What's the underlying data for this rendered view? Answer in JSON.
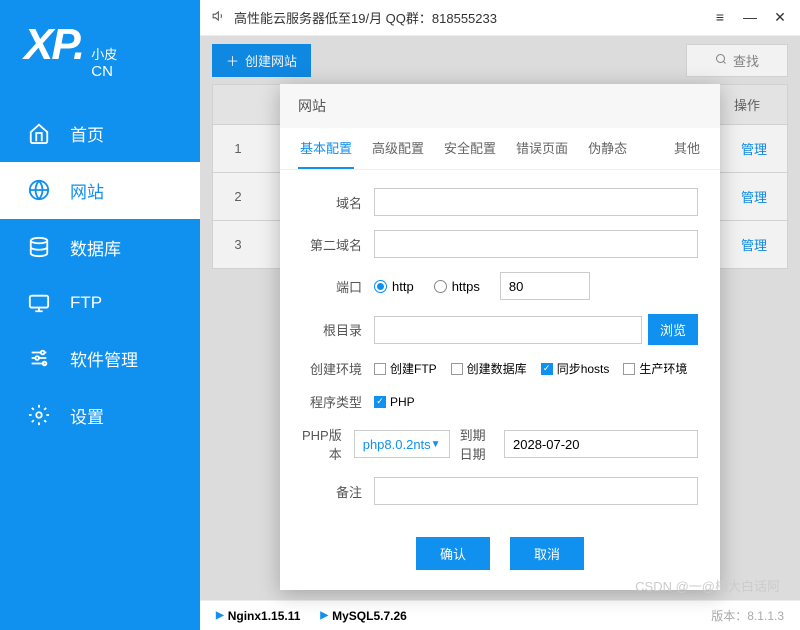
{
  "logo": {
    "main": "XP.",
    "sub1": "小皮",
    "sub2": "CN"
  },
  "titlebar": {
    "text": "高性能云服务器低至19/月  QQ群：818555233"
  },
  "nav": [
    {
      "label": "首页"
    },
    {
      "label": "网站"
    },
    {
      "label": "数据库"
    },
    {
      "label": "FTP"
    },
    {
      "label": "软件管理"
    },
    {
      "label": "设置"
    }
  ],
  "toolbar": {
    "create": "创建网站",
    "search": "查找"
  },
  "table": {
    "header_op": "操作",
    "rows": [
      {
        "idx": "1",
        "manage": "管理"
      },
      {
        "idx": "2",
        "manage": "管理"
      },
      {
        "idx": "3",
        "manage": "管理"
      }
    ]
  },
  "modal": {
    "title": "网站",
    "tabs": [
      "基本配置",
      "高级配置",
      "安全配置",
      "错误页面",
      "伪静态",
      "其他"
    ],
    "labels": {
      "domain": "域名",
      "domain2": "第二域名",
      "port": "端口",
      "root": "根目录",
      "env": "创建环境",
      "type": "程序类型",
      "php": "PHP版本",
      "expire": "到期日期",
      "remark": "备注"
    },
    "port": {
      "http": "http",
      "https": "https",
      "value": "80"
    },
    "browse": "浏览",
    "env_opts": {
      "ftp": "创建FTP",
      "db": "创建数据库",
      "hosts": "同步hosts",
      "prod": "生产环境"
    },
    "type_php": "PHP",
    "php_version": "php8.0.2nts",
    "expire_date": "2028-07-20",
    "confirm": "确认",
    "cancel": "取消"
  },
  "status": {
    "nginx": "Nginx1.15.11",
    "mysql": "MySQL5.7.26",
    "version": "版本：8.1.1.3"
  },
  "watermark": "CSDN @一@楠大白话阿"
}
